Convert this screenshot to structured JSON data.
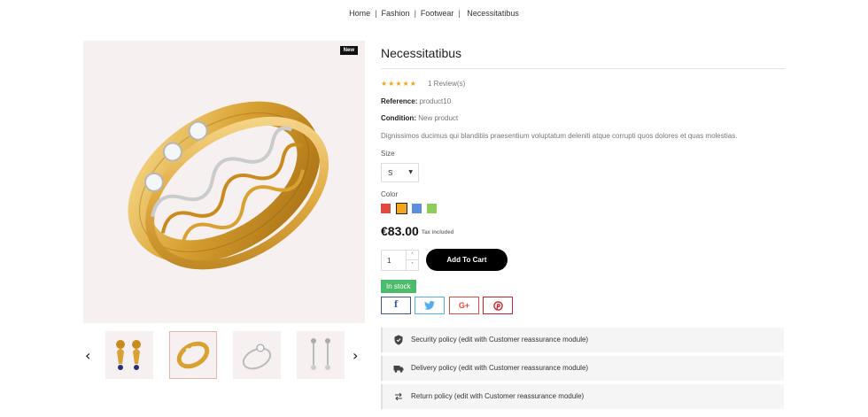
{
  "breadcrumb": {
    "items": [
      "Home",
      "Fashion",
      "Footwear",
      "Necessitatibus"
    ],
    "separator": "|"
  },
  "gallery": {
    "badge": "New",
    "prev_icon": "chevron-left-icon",
    "next_icon": "chevron-right-icon",
    "thumbnails": [
      {
        "name": "earrings-thumbnail",
        "selected": false
      },
      {
        "name": "gold-ring-thumbnail",
        "selected": true
      },
      {
        "name": "silver-ring-thumbnail",
        "selected": false
      },
      {
        "name": "drop-earrings-thumbnail",
        "selected": false
      }
    ]
  },
  "product": {
    "title": "Necessitatibus",
    "rating_stars": "★★★★★",
    "rating": 5,
    "reviews": "1 Review(s)",
    "reference_label": "Reference:",
    "reference_value": "product10",
    "condition_label": "Condition:",
    "condition_value": "New product",
    "description": "Dignissimos ducimus qui blanditiis praesentium voluptatum deleniti atque corrupti quos dolores et quas molestias.",
    "size_label": "Size",
    "size_value": "S",
    "color_label": "Color",
    "colors": [
      "#e04a3f",
      "#f2a619",
      "#5b8fdd",
      "#8ccc5b"
    ],
    "selected_color_index": 1,
    "price": "€83.00",
    "tax": "Tax included",
    "quantity": "1",
    "add_to_cart": "Add To Cart",
    "stock": "In stock",
    "share": {
      "facebook": "f",
      "twitter": "🐦",
      "googleplus": "G+",
      "pinterest": "P"
    }
  },
  "reassurance": [
    {
      "icon": "shield-icon",
      "text": "Security policy (edit with Customer reassurance module)"
    },
    {
      "icon": "truck-icon",
      "text": "Delivery policy (edit with Customer reassurance module)"
    },
    {
      "icon": "arrows-icon",
      "text": "Return policy (edit with Customer reassurance module)"
    }
  ],
  "colors": {
    "stock": "#4cbb6c",
    "star": "#f2a619",
    "facebook": "#3b5998",
    "twitter": "#55acee",
    "googleplus": "#dd4b39",
    "pinterest": "#cb2027"
  }
}
